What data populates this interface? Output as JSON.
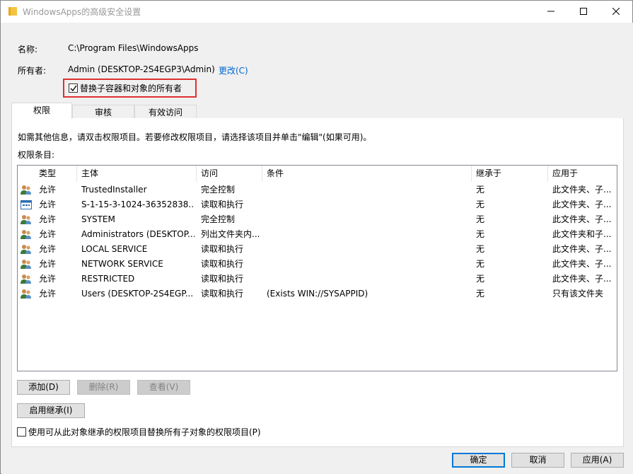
{
  "window": {
    "title": "WindowsApps的高级安全设置"
  },
  "info": {
    "name_label": "名称:",
    "name_value": "C:\\Program Files\\WindowsApps",
    "owner_label": "所有者:",
    "owner_value": "Admin (DESKTOP-2S4EGP3\\Admin)",
    "change_link": "更改(C)",
    "replace_owner_label": "替换子容器和对象的所有者",
    "replace_owner_checked": true
  },
  "tabs": [
    {
      "label": "权限",
      "active": true
    },
    {
      "label": "审核",
      "active": false
    },
    {
      "label": "有效访问",
      "active": false
    }
  ],
  "permissions": {
    "help_text": "如需其他信息，请双击权限项目。若要修改权限项目，请选择该项目并单击\"编辑\"(如果可用)。",
    "entries_label": "权限条目:",
    "columns": [
      "类型",
      "主体",
      "访问",
      "条件",
      "继承于",
      "应用于"
    ],
    "rows": [
      {
        "icon": "users-icon",
        "type": "允许",
        "principal": "TrustedInstaller",
        "access": "完全控制",
        "condition": "",
        "inherited": "无",
        "applies": "此文件夹、子..."
      },
      {
        "icon": "sid-icon",
        "type": "允许",
        "principal": "S-1-15-3-1024-36352838...",
        "access": "读取和执行",
        "condition": "",
        "inherited": "无",
        "applies": "此文件夹、子..."
      },
      {
        "icon": "users-icon",
        "type": "允许",
        "principal": "SYSTEM",
        "access": "完全控制",
        "condition": "",
        "inherited": "无",
        "applies": "此文件夹、子..."
      },
      {
        "icon": "users-icon",
        "type": "允许",
        "principal": "Administrators (DESKTOP...",
        "access": "列出文件夹内...",
        "condition": "",
        "inherited": "无",
        "applies": "此文件夹和子..."
      },
      {
        "icon": "users-icon",
        "type": "允许",
        "principal": "LOCAL SERVICE",
        "access": "读取和执行",
        "condition": "",
        "inherited": "无",
        "applies": "此文件夹、子..."
      },
      {
        "icon": "users-icon",
        "type": "允许",
        "principal": "NETWORK SERVICE",
        "access": "读取和执行",
        "condition": "",
        "inherited": "无",
        "applies": "此文件夹、子..."
      },
      {
        "icon": "users-icon",
        "type": "允许",
        "principal": "RESTRICTED",
        "access": "读取和执行",
        "condition": "",
        "inherited": "无",
        "applies": "此文件夹、子..."
      },
      {
        "icon": "users-icon",
        "type": "允许",
        "principal": "Users (DESKTOP-2S4EGP...",
        "access": "读取和执行",
        "condition": "(Exists WIN://SYSAPPID)",
        "inherited": "无",
        "applies": "只有该文件夹"
      }
    ],
    "add_button": "添加(D)",
    "remove_button": "删除(R)",
    "view_button": "查看(V)",
    "enable_inheritance_button": "启用继承(I)",
    "replace_child_label": "使用可从此对象继承的权限项目替换所有子对象的权限项目(P)",
    "replace_child_checked": false
  },
  "footer": {
    "ok": "确定",
    "cancel": "取消",
    "apply": "应用(A)"
  }
}
